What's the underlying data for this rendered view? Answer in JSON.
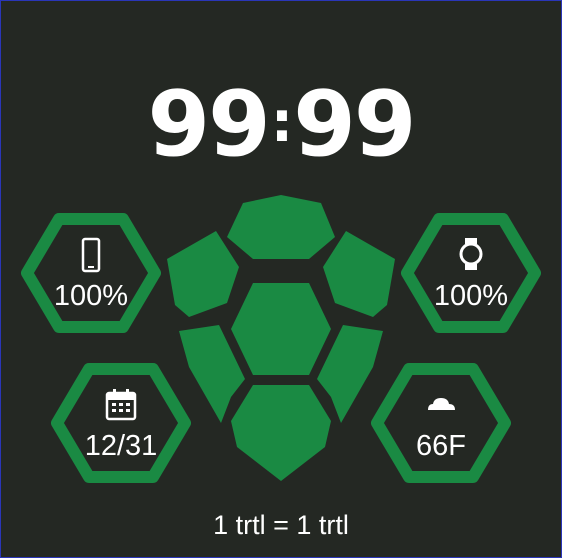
{
  "watchface": {
    "time": {
      "hours": "99",
      "separator": ":",
      "minutes": "99"
    },
    "complications": {
      "phone_battery": {
        "value": "100%",
        "icon": "phone-icon"
      },
      "watch_battery": {
        "value": "100%",
        "icon": "watch-icon"
      },
      "date": {
        "value": "12/31",
        "icon": "calendar-icon"
      },
      "weather": {
        "value": "66F",
        "icon": "cloud-icon"
      }
    },
    "footer": "1 trtl = 1 trtl",
    "colors": {
      "background": "#242823",
      "accent_green": "#1a8a43",
      "text": "#ffffff",
      "border": "#2a36b8"
    }
  }
}
